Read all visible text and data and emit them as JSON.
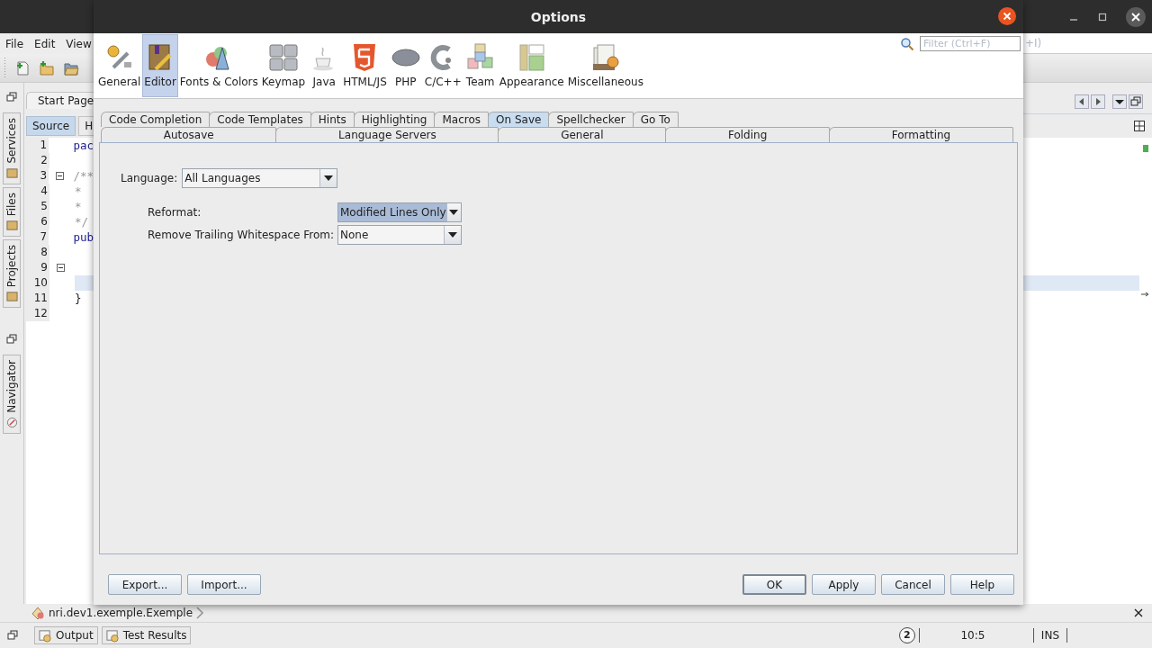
{
  "ide": {
    "menu": [
      "File",
      "Edit",
      "View"
    ],
    "quick_search_fragment": "+I)",
    "side_tabs": [
      "Services",
      "Files",
      "Projects"
    ],
    "navigator_tab": "Navigator",
    "editor_tab": "Start Page",
    "view_tabs": [
      {
        "label": "Source",
        "selected": true
      },
      {
        "label": "H",
        "selected": false
      }
    ],
    "lines": [
      {
        "number": "1",
        "code": "pac",
        "kind": "keyword",
        "fold": false,
        "current": false
      },
      {
        "number": "2",
        "fold": false,
        "current": false
      },
      {
        "number": "3",
        "code": "/**",
        "kind": "comment",
        "fold": true,
        "current": false
      },
      {
        "number": "4",
        "code": "*",
        "kind": "comment",
        "fold": false,
        "current": false
      },
      {
        "number": "5",
        "code": "*",
        "kind": "comment",
        "fold": false,
        "current": false
      },
      {
        "number": "6",
        "code": "*/",
        "kind": "comment",
        "fold": false,
        "current": false
      },
      {
        "number": "7",
        "code": "pub",
        "kind": "keyword",
        "fold": false,
        "current": false
      },
      {
        "number": "8",
        "fold": false,
        "current": false
      },
      {
        "number": "9",
        "fold": true,
        "current": false
      },
      {
        "number": "10",
        "fold": false,
        "current": true
      },
      {
        "number": "11",
        "code": "}",
        "kind": "plain",
        "fold": false,
        "current": false
      },
      {
        "number": "12",
        "fold": false,
        "current": false
      }
    ],
    "breadcrumb": "nri.dev1.exemple.Exemple",
    "bottom_tabs": [
      "Output",
      "Test Results"
    ],
    "status": {
      "notifications": "2",
      "position": "10:5",
      "mode": "INS"
    }
  },
  "dialog": {
    "title": "Options",
    "filter_placeholder": "Filter (Ctrl+F)",
    "categories": [
      {
        "label": "General",
        "selected": false
      },
      {
        "label": "Editor",
        "selected": true
      },
      {
        "label": "Fonts & Colors",
        "selected": false
      },
      {
        "label": "Keymap",
        "selected": false
      },
      {
        "label": "Java",
        "selected": false
      },
      {
        "label": "HTML/JS",
        "selected": false
      },
      {
        "label": "PHP",
        "selected": false
      },
      {
        "label": "C/C++",
        "selected": false
      },
      {
        "label": "Team",
        "selected": false
      },
      {
        "label": "Appearance",
        "selected": false
      },
      {
        "label": "Miscellaneous",
        "selected": false
      }
    ],
    "tabs_row_1": [
      {
        "label": "Code Completion",
        "selected": false
      },
      {
        "label": "Code Templates",
        "selected": false
      },
      {
        "label": "Hints",
        "selected": false
      },
      {
        "label": "Highlighting",
        "selected": false
      },
      {
        "label": "Macros",
        "selected": false
      },
      {
        "label": "On Save",
        "selected": true
      },
      {
        "label": "Spellchecker",
        "selected": false
      },
      {
        "label": "Go To",
        "selected": false
      }
    ],
    "tabs_row_2": [
      {
        "label": "Autosave",
        "selected": false
      },
      {
        "label": "Language Servers",
        "selected": false
      },
      {
        "label": "General",
        "selected": false
      },
      {
        "label": "Folding",
        "selected": false
      },
      {
        "label": "Formatting",
        "selected": false
      }
    ],
    "language": {
      "label": "Language:",
      "value": "All Languages"
    },
    "options": [
      {
        "label": "Reformat:",
        "value": "Modified Lines Only",
        "focused": true
      },
      {
        "label": "Remove Trailing Whitespace From:",
        "value": "None",
        "focused": false
      }
    ],
    "left_buttons": [
      "Export...",
      "Import..."
    ],
    "right_buttons": [
      {
        "label": "OK",
        "default": true
      },
      {
        "label": "Apply",
        "default": false
      },
      {
        "label": "Cancel",
        "default": false
      },
      {
        "label": "Help",
        "default": false
      }
    ]
  }
}
